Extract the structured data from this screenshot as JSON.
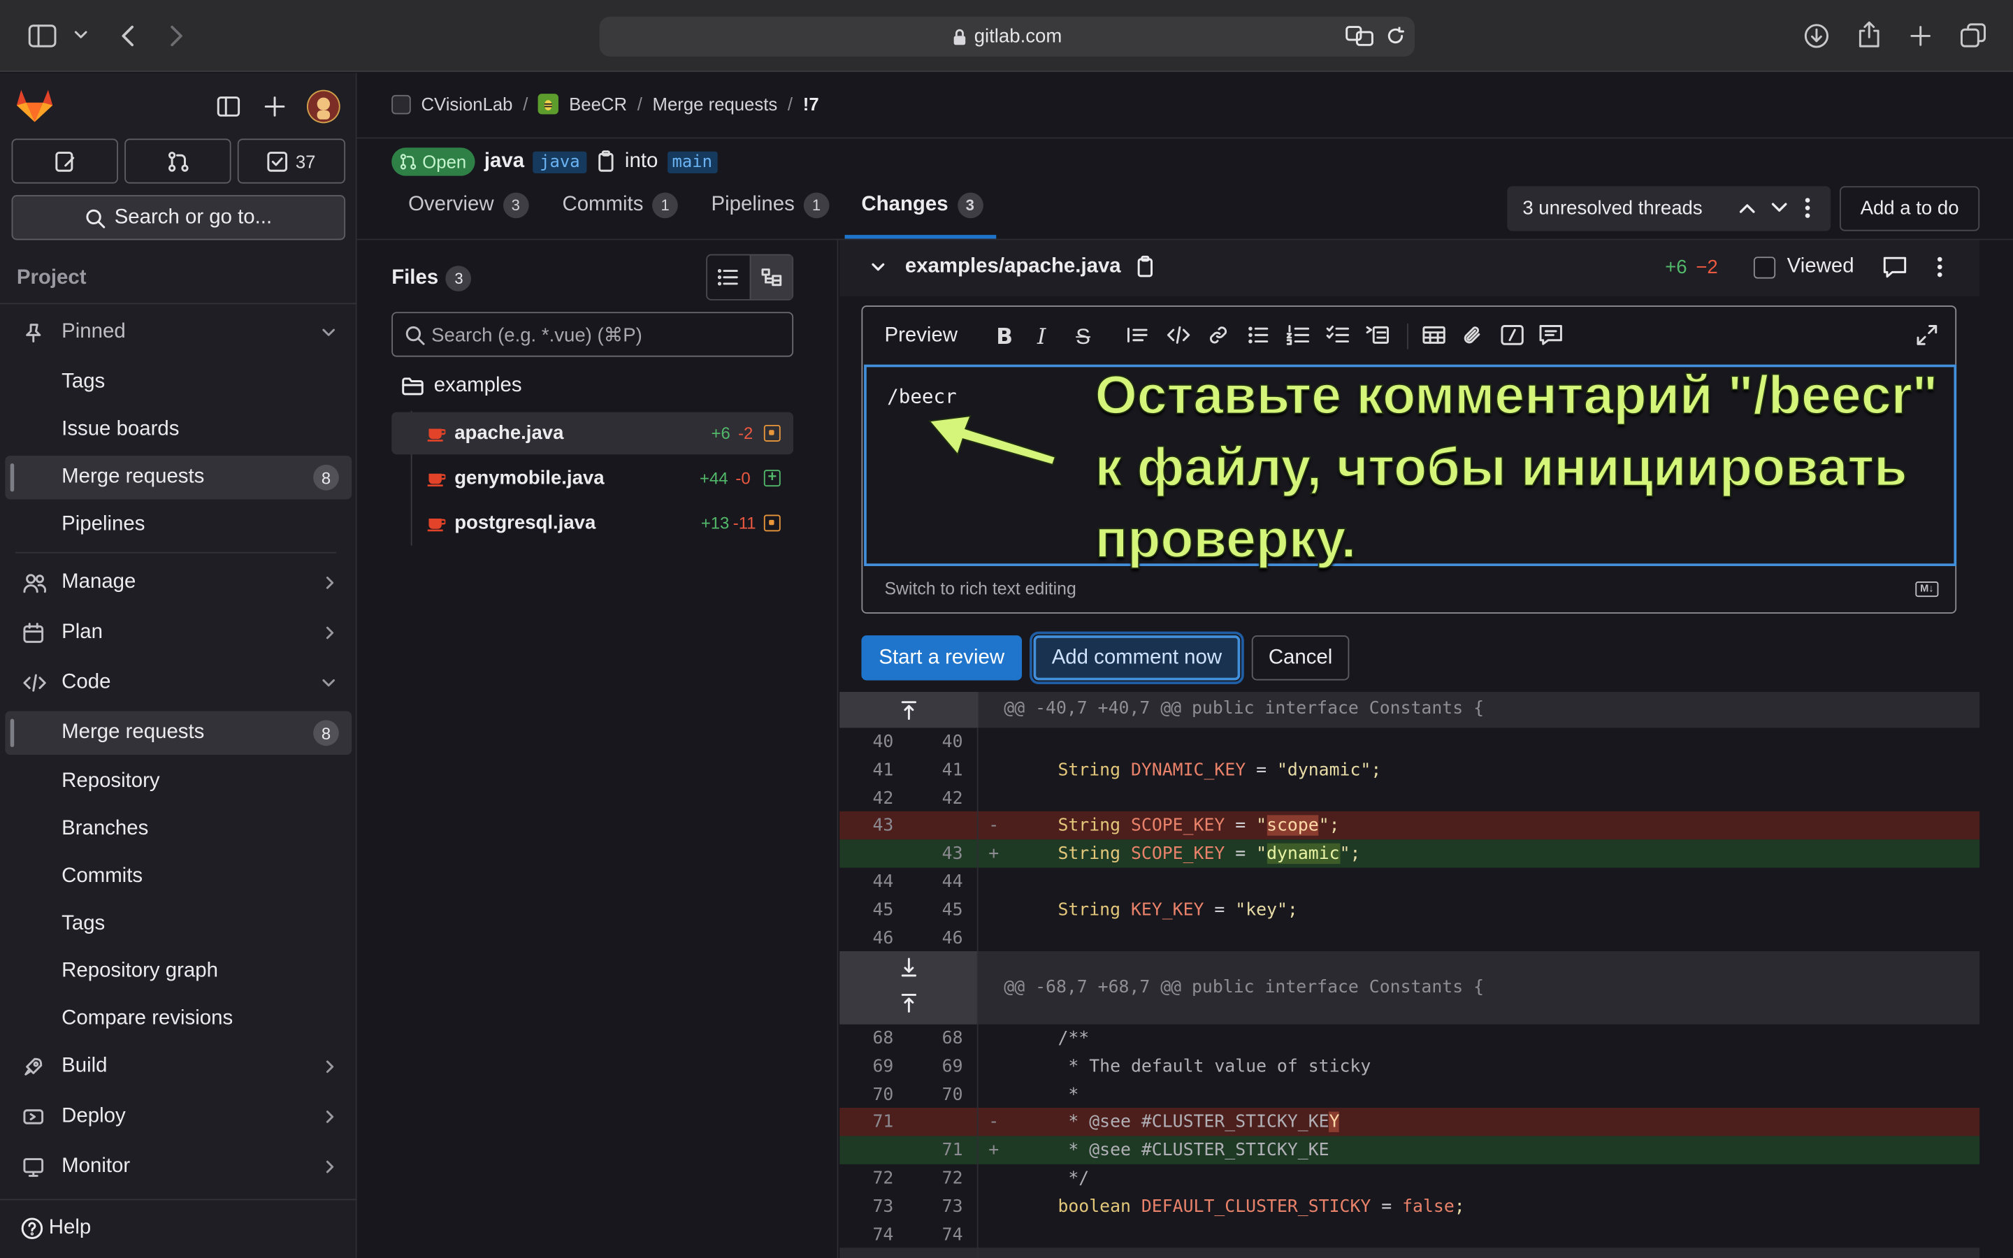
{
  "browser": {
    "url": "gitlab.com"
  },
  "sidebar": {
    "todo_count": "37",
    "search_label": "Search or go to...",
    "section_label": "Project",
    "pinned_label": "Pinned",
    "pinned_items": [
      {
        "label": "Tags"
      },
      {
        "label": "Issue boards"
      },
      {
        "label": "Merge requests",
        "count": "8"
      },
      {
        "label": "Pipelines"
      }
    ],
    "groups": [
      {
        "label": "Manage"
      },
      {
        "label": "Plan"
      },
      {
        "label": "Code"
      }
    ],
    "code_items": [
      {
        "label": "Merge requests",
        "count": "8"
      },
      {
        "label": "Repository"
      },
      {
        "label": "Branches"
      },
      {
        "label": "Commits"
      },
      {
        "label": "Tags"
      },
      {
        "label": "Repository graph"
      },
      {
        "label": "Compare revisions"
      }
    ],
    "bottom_groups": [
      {
        "label": "Build"
      },
      {
        "label": "Deploy"
      },
      {
        "label": "Monitor"
      }
    ],
    "help_label": "Help"
  },
  "breadcrumb": {
    "items": [
      "CVisionLab",
      "BeeCR",
      "Merge requests",
      "!7"
    ]
  },
  "mr": {
    "status": "Open",
    "title": "java",
    "source_branch": "java",
    "into_label": "into",
    "target_branch": "main"
  },
  "tabs": [
    {
      "label": "Overview",
      "count": "3"
    },
    {
      "label": "Commits",
      "count": "1"
    },
    {
      "label": "Pipelines",
      "count": "1"
    },
    {
      "label": "Changes",
      "count": "3"
    }
  ],
  "threads": {
    "label": "3 unresolved threads",
    "todo_button": "Add a to do"
  },
  "files": {
    "title": "Files",
    "count": "3",
    "search_placeholder": "Search (e.g. *.vue) (⌘P)",
    "folder": "examples",
    "items": [
      {
        "name": "apache.java",
        "add": "+6",
        "del": "-2"
      },
      {
        "name": "genymobile.java",
        "add": "+44",
        "del": "-0"
      },
      {
        "name": "postgresql.java",
        "add": "+13",
        "del": "-11"
      }
    ]
  },
  "diff_header": {
    "path": "examples/apache.java",
    "add": "+6",
    "del": "−2",
    "viewed_label": "Viewed"
  },
  "editor": {
    "preview_label": "Preview",
    "text": "/beecr",
    "switch_label": "Switch to rich text editing",
    "md_badge": "M↓",
    "start_review": "Start a review",
    "add_comment": "Add comment now",
    "cancel": "Cancel"
  },
  "annotation": {
    "line1": "Оставьте комментарий \"/beecr\"",
    "line2": "к файлу, чтобы инициировать",
    "line3": "проверку."
  },
  "hunks": [
    "@@ -40,7 +40,7 @@ public interface Constants {",
    "@@ -68,7 +68,7 @@ public interface Constants {"
  ],
  "diff_lines_1": [
    {
      "old": "40",
      "new": "40",
      "type": "ctx",
      "kw": "",
      "var": "",
      "eq": "",
      "str": "",
      "hl": "",
      "end": ""
    },
    {
      "old": "41",
      "new": "41",
      "type": "ctx",
      "kw": "String ",
      "var": "DYNAMIC_KEY",
      "eq": " = ",
      "str": "\"dynamic\"",
      "hl": "",
      "end": ";"
    },
    {
      "old": "42",
      "new": "42",
      "type": "ctx",
      "kw": "",
      "var": "",
      "eq": "",
      "str": "",
      "hl": "",
      "end": ""
    },
    {
      "old": "43",
      "new": "",
      "type": "del",
      "kw": "String ",
      "var": "SCOPE_KEY",
      "eq": " = ",
      "str": "\"",
      "hl": "scope",
      "end": "\";"
    },
    {
      "old": "",
      "new": "43",
      "type": "add",
      "kw": "String ",
      "var": "SCOPE_KEY",
      "eq": " = ",
      "str": "\"",
      "hl": "dynamic",
      "end": "\";"
    },
    {
      "old": "44",
      "new": "44",
      "type": "ctx",
      "kw": "",
      "var": "",
      "eq": "",
      "str": "",
      "hl": "",
      "end": ""
    },
    {
      "old": "45",
      "new": "45",
      "type": "ctx",
      "kw": "String ",
      "var": "KEY_KEY",
      "eq": " = ",
      "str": "\"key\"",
      "hl": "",
      "end": ";"
    },
    {
      "old": "46",
      "new": "46",
      "type": "ctx",
      "kw": "",
      "var": "",
      "eq": "",
      "str": "",
      "hl": "",
      "end": ""
    }
  ],
  "diff_lines_2": [
    {
      "old": "68",
      "new": "68",
      "type": "ctx",
      "text": "/**"
    },
    {
      "old": "69",
      "new": "69",
      "type": "ctx",
      "text": " * The default value of sticky"
    },
    {
      "old": "70",
      "new": "70",
      "type": "ctx",
      "text": " *"
    },
    {
      "old": "71",
      "new": "",
      "type": "del",
      "text": " * @see #CLUSTER_STICKY_KE",
      "hl": "Y"
    },
    {
      "old": "",
      "new": "71",
      "type": "add",
      "text": " * @see #CLUSTER_STICKY_KE",
      "hl": ""
    },
    {
      "old": "72",
      "new": "72",
      "type": "ctx",
      "text": " */"
    },
    {
      "old": "73",
      "new": "73",
      "type": "ctx",
      "text": "",
      "kw": "boolean ",
      "var": "DEFAULT_CLUSTER_STICKY",
      "eq": " = ",
      "str": "false",
      "end": ";"
    },
    {
      "old": "74",
      "new": "74",
      "type": "ctx",
      "text": ""
    }
  ],
  "colors": {
    "accent": "#1f75cb",
    "annotation": "#d4f57a",
    "add": "#52b86a",
    "del": "#ec5941"
  }
}
